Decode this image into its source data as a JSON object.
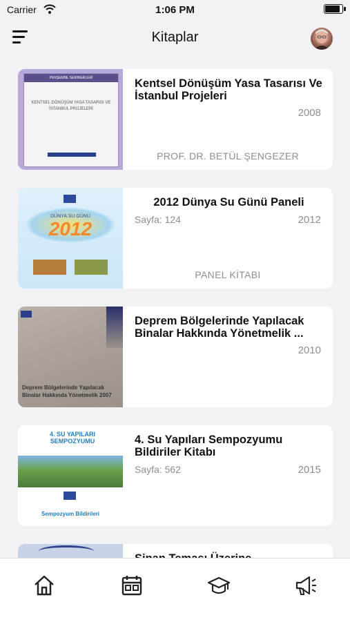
{
  "status": {
    "carrier": "Carrier",
    "time": "1:06 PM",
    "battery_level": 0.95
  },
  "header": {
    "title": "Kitaplar"
  },
  "books": [
    {
      "title": "Kentsel Dönüşüm Yasa Tasarısı Ve İstanbul Projeleri",
      "year": "2008",
      "author": "PROF. DR. BETÜL ŞENGEZER"
    },
    {
      "title": "2012 Dünya Su Günü Paneli",
      "pages": "Sayfa: 124",
      "year": "2012",
      "author": "PANEL KİTABI"
    },
    {
      "title": "Deprem Bölgelerinde Yapılacak Binalar Hakkında Yönetmelik ...",
      "year": "2010"
    },
    {
      "title": "4. Su Yapıları Sempozyumu Bildiriler Kitabı",
      "pages": "Sayfa: 562",
      "year": "2015"
    },
    {
      "title": "Sinan Teması Üzerine"
    }
  ],
  "covers": {
    "book1": {
      "header": "PERŞEMBE SEMİNERLERİ",
      "title": "KENTSEL DÖNÜŞÜM YASA TASARISI VE İSTANBUL PROJELERİ"
    },
    "book2": {
      "badge": "DÜNYA SU GÜNÜ",
      "year": "2012"
    },
    "book3": {
      "title": "Deprem Bölgelerinde Yapılacak Binalar Hakkında Yönetmelik 2007"
    },
    "book4": {
      "headline": "4. SU YAPILARI SEMPOZYUMU",
      "footer": "Sempozyum Bildirileri"
    }
  },
  "tabs": [
    "home-icon",
    "calendar-icon",
    "graduation-cap-icon",
    "megaphone-icon"
  ]
}
